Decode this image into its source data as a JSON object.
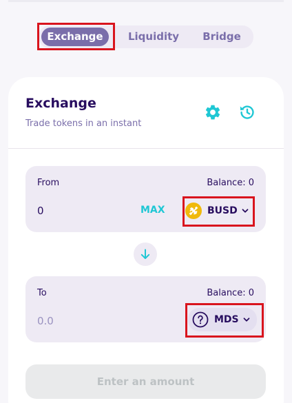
{
  "tabs": {
    "exchange": "Exchange",
    "liquidity": "Liquidity",
    "bridge": "Bridge"
  },
  "card": {
    "title": "Exchange",
    "subtitle": "Trade tokens in an instant",
    "icons": [
      "gear-icon",
      "history-icon"
    ]
  },
  "from": {
    "label": "From",
    "balance": "Balance: 0",
    "amount": "0",
    "max_label": "MAX",
    "token": {
      "symbol": "BUSD",
      "icon": "busd-token-icon"
    }
  },
  "to": {
    "label": "To",
    "balance": "Balance: 0",
    "amount_placeholder": "0.0",
    "token": {
      "symbol": "MDS",
      "icon": "question-circle-icon"
    }
  },
  "swap_icon": "arrow-down-icon",
  "cta_label": "Enter an amount",
  "colors": {
    "primary": "#7a6eaa",
    "accent": "#1fc7d4",
    "text": "#280d5f",
    "highlight": "#d9141d",
    "busd": "#f0b90b"
  }
}
